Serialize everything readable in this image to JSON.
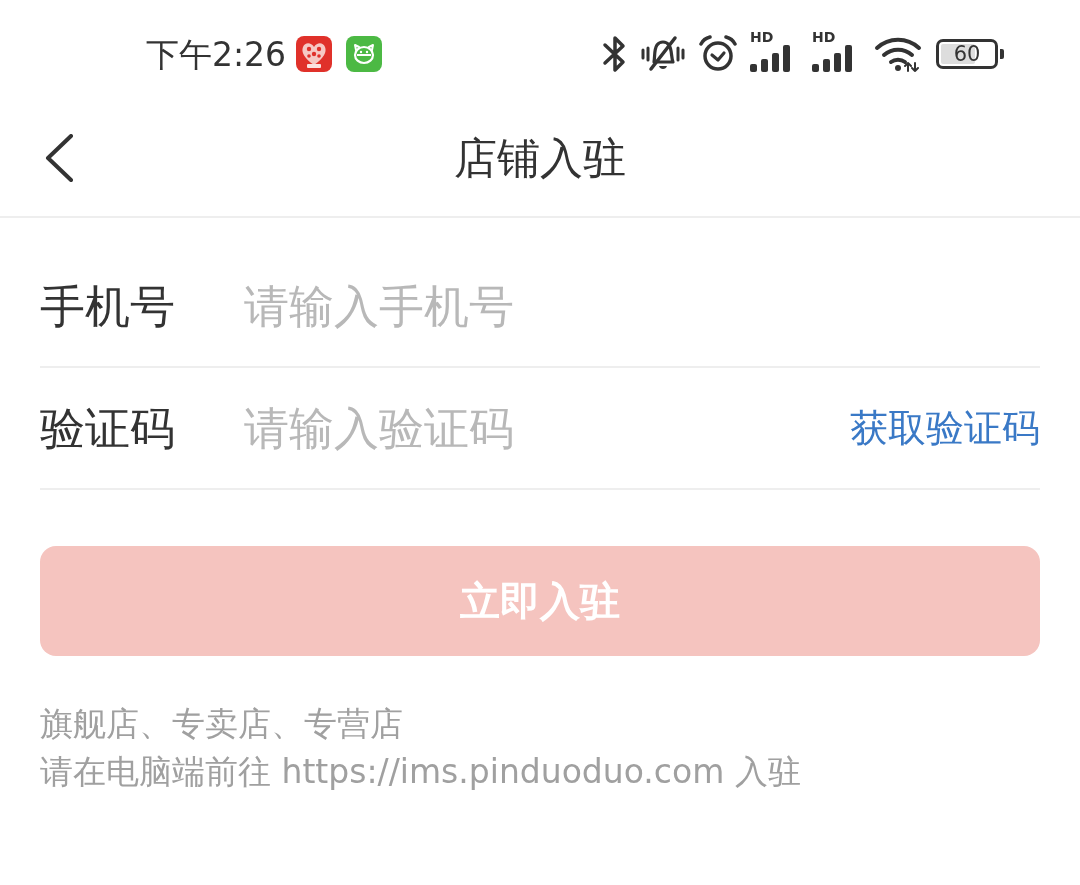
{
  "status_bar": {
    "time": "下午2:26",
    "signals": [
      {
        "label": "HD"
      },
      {
        "label": "HD"
      }
    ],
    "battery": "60"
  },
  "header": {
    "title": "店铺入驻"
  },
  "form": {
    "fields": [
      {
        "label": "手机号",
        "placeholder": "请输入手机号"
      },
      {
        "label": "验证码",
        "placeholder": "请输入验证码",
        "action": "获取验证码"
      }
    ]
  },
  "submit_button": {
    "label": "立即入驻",
    "disabled": true
  },
  "notes": [
    "旗舰店、专卖店、专营店",
    "请在电脑端前往 https://ims.pinduoduo.com 入驻"
  ]
}
